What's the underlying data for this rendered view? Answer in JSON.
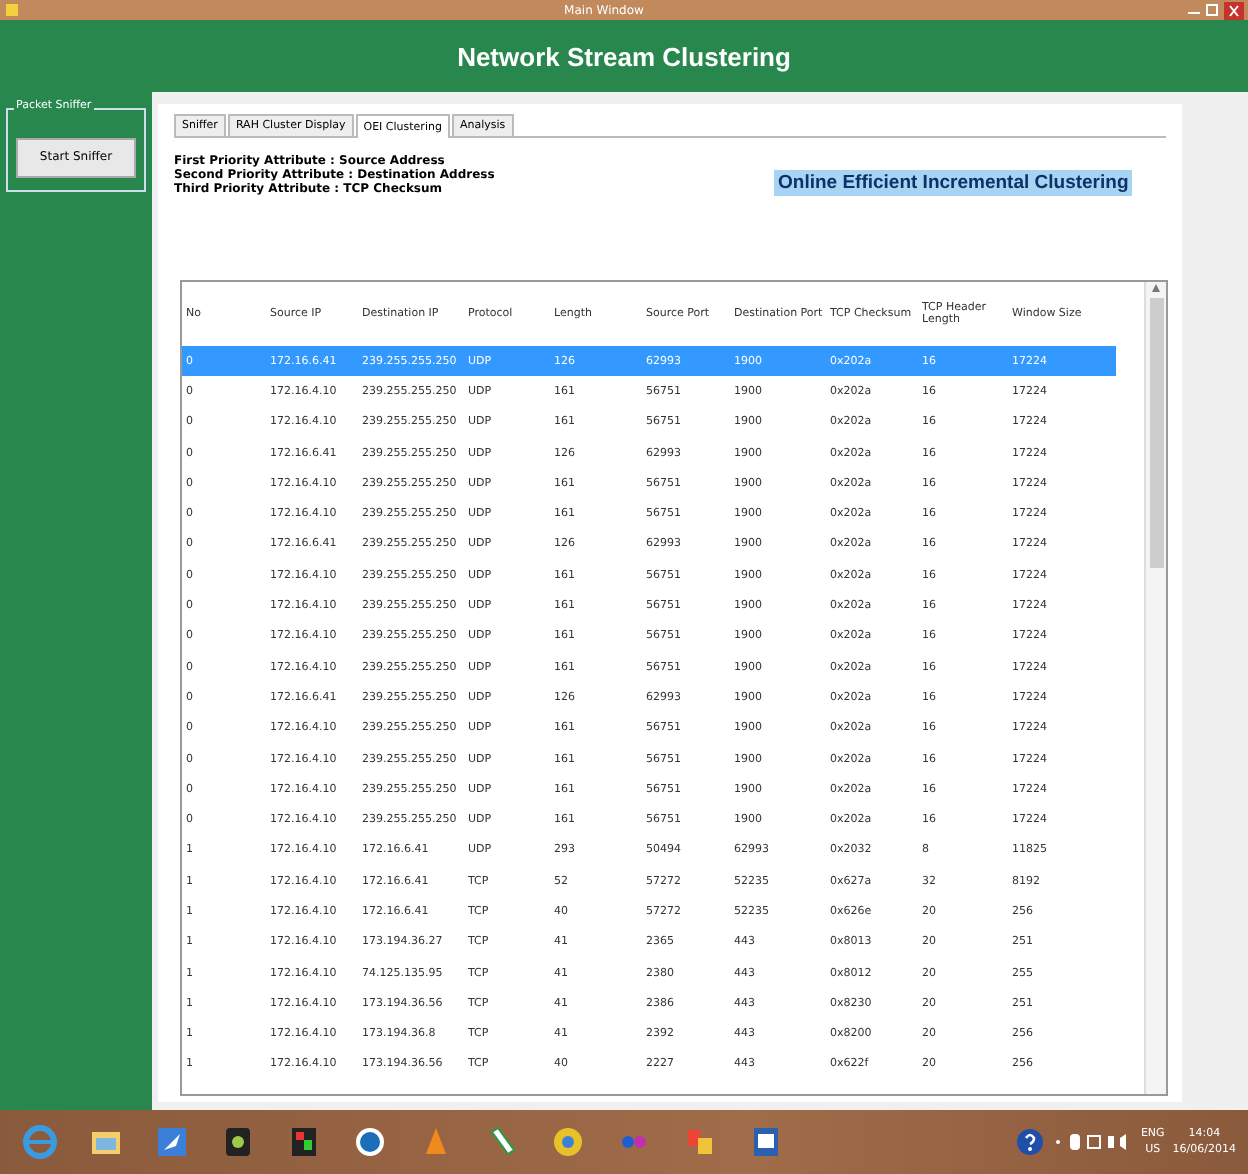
{
  "window": {
    "title": "Main Window"
  },
  "header": {
    "title": "Network Stream Clustering"
  },
  "sidebar": {
    "group_title": "Packet Sniffer",
    "button": "Start Sniffer"
  },
  "tabs": [
    {
      "label": "Sniffer",
      "selected": false
    },
    {
      "label": "RAH Cluster Display",
      "selected": false
    },
    {
      "label": "OEI Clustering",
      "selected": true
    },
    {
      "label": "Analysis",
      "selected": false
    }
  ],
  "priorities": [
    "First Priority Attribute : Source Address",
    "Second Priority Attribute : Destination Address",
    "Third Priority Attribute : TCP Checksum"
  ],
  "banner": "Online Efficient Incremental Clustering",
  "table": {
    "columns": [
      "No",
      "Source IP",
      "Destination IP",
      "Protocol",
      "Length",
      "Source Port",
      "Destination Port",
      "TCP Checksum",
      "TCP Header Length",
      "Window Size"
    ],
    "rows": [
      {
        "selected": true,
        "cells": [
          "0",
          "172.16.6.41",
          "239.255.255.250",
          "UDP",
          "126",
          "62993",
          "1900",
          "0x202a",
          "16",
          "17224"
        ]
      },
      {
        "selected": false,
        "cells": [
          "0",
          "172.16.4.10",
          "239.255.255.250",
          "UDP",
          "161",
          "56751",
          "1900",
          "0x202a",
          "16",
          "17224"
        ]
      },
      {
        "selected": false,
        "cells": [
          "0",
          "172.16.4.10",
          "239.255.255.250",
          "UDP",
          "161",
          "56751",
          "1900",
          "0x202a",
          "16",
          "17224"
        ]
      },
      {
        "selected": false,
        "cells": [
          "0",
          "172.16.6.41",
          "239.255.255.250",
          "UDP",
          "126",
          "62993",
          "1900",
          "0x202a",
          "16",
          "17224"
        ]
      },
      {
        "selected": false,
        "cells": [
          "0",
          "172.16.4.10",
          "239.255.255.250",
          "UDP",
          "161",
          "56751",
          "1900",
          "0x202a",
          "16",
          "17224"
        ]
      },
      {
        "selected": false,
        "cells": [
          "0",
          "172.16.4.10",
          "239.255.255.250",
          "UDP",
          "161",
          "56751",
          "1900",
          "0x202a",
          "16",
          "17224"
        ]
      },
      {
        "selected": false,
        "cells": [
          "0",
          "172.16.6.41",
          "239.255.255.250",
          "UDP",
          "126",
          "62993",
          "1900",
          "0x202a",
          "16",
          "17224"
        ]
      },
      {
        "selected": false,
        "cells": [
          "0",
          "172.16.4.10",
          "239.255.255.250",
          "UDP",
          "161",
          "56751",
          "1900",
          "0x202a",
          "16",
          "17224"
        ]
      },
      {
        "selected": false,
        "cells": [
          "0",
          "172.16.4.10",
          "239.255.255.250",
          "UDP",
          "161",
          "56751",
          "1900",
          "0x202a",
          "16",
          "17224"
        ]
      },
      {
        "selected": false,
        "cells": [
          "0",
          "172.16.4.10",
          "239.255.255.250",
          "UDP",
          "161",
          "56751",
          "1900",
          "0x202a",
          "16",
          "17224"
        ]
      },
      {
        "selected": false,
        "cells": [
          "0",
          "172.16.4.10",
          "239.255.255.250",
          "UDP",
          "161",
          "56751",
          "1900",
          "0x202a",
          "16",
          "17224"
        ]
      },
      {
        "selected": false,
        "cells": [
          "0",
          "172.16.6.41",
          "239.255.255.250",
          "UDP",
          "126",
          "62993",
          "1900",
          "0x202a",
          "16",
          "17224"
        ]
      },
      {
        "selected": false,
        "cells": [
          "0",
          "172.16.4.10",
          "239.255.255.250",
          "UDP",
          "161",
          "56751",
          "1900",
          "0x202a",
          "16",
          "17224"
        ]
      },
      {
        "selected": false,
        "cells": [
          "0",
          "172.16.4.10",
          "239.255.255.250",
          "UDP",
          "161",
          "56751",
          "1900",
          "0x202a",
          "16",
          "17224"
        ]
      },
      {
        "selected": false,
        "cells": [
          "0",
          "172.16.4.10",
          "239.255.255.250",
          "UDP",
          "161",
          "56751",
          "1900",
          "0x202a",
          "16",
          "17224"
        ]
      },
      {
        "selected": false,
        "cells": [
          "0",
          "172.16.4.10",
          "239.255.255.250",
          "UDP",
          "161",
          "56751",
          "1900",
          "0x202a",
          "16",
          "17224"
        ]
      },
      {
        "selected": false,
        "cells": [
          "1",
          "172.16.4.10",
          "172.16.6.41",
          "UDP",
          "293",
          "50494",
          "62993",
          "0x2032",
          "8",
          "11825"
        ]
      },
      {
        "selected": false,
        "cells": [
          "1",
          "172.16.4.10",
          "172.16.6.41",
          "TCP",
          "52",
          "57272",
          "52235",
          "0x627a",
          "32",
          "8192"
        ]
      },
      {
        "selected": false,
        "cells": [
          "1",
          "172.16.4.10",
          "172.16.6.41",
          "TCP",
          "40",
          "57272",
          "52235",
          "0x626e",
          "20",
          "256"
        ]
      },
      {
        "selected": false,
        "cells": [
          "1",
          "172.16.4.10",
          "173.194.36.27",
          "TCP",
          "41",
          "2365",
          "443",
          "0x8013",
          "20",
          "251"
        ]
      },
      {
        "selected": false,
        "cells": [
          "1",
          "172.16.4.10",
          "74.125.135.95",
          "TCP",
          "41",
          "2380",
          "443",
          "0x8012",
          "20",
          "255"
        ]
      },
      {
        "selected": false,
        "cells": [
          "1",
          "172.16.4.10",
          "173.194.36.56",
          "TCP",
          "41",
          "2386",
          "443",
          "0x8230",
          "20",
          "251"
        ]
      },
      {
        "selected": false,
        "cells": [
          "1",
          "172.16.4.10",
          "173.194.36.8",
          "TCP",
          "41",
          "2392",
          "443",
          "0x8200",
          "20",
          "256"
        ]
      },
      {
        "selected": false,
        "cells": [
          "1",
          "172.16.4.10",
          "173.194.36.56",
          "TCP",
          "40",
          "2227",
          "443",
          "0x622f",
          "20",
          "256"
        ]
      }
    ]
  },
  "taskbar": {
    "language": "ENG",
    "region": "US",
    "time": "14:04",
    "date": "16/06/2014"
  }
}
